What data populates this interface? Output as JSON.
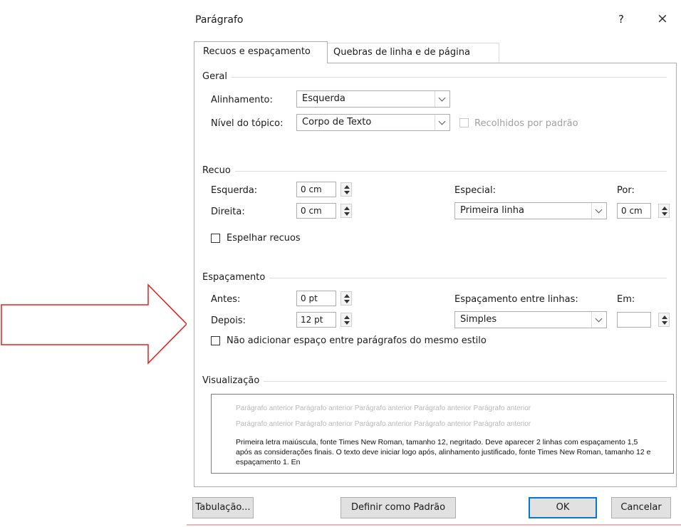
{
  "dialog": {
    "title": "Parágrafo",
    "help_label": "?",
    "close_label": "×"
  },
  "tabs": [
    {
      "label": "Recuos e espaçamento",
      "active": true
    },
    {
      "label": "Quebras de linha e de página",
      "active": false
    }
  ],
  "geral": {
    "section_label": "Geral",
    "alinhamento_label": "Alinhamento:",
    "alinhamento_value": "Esquerda",
    "nivel_label": "Nível do tópico:",
    "nivel_value": "Corpo de Texto",
    "recolhidos_label": "Recolhidos por padrão",
    "recolhidos_checked": false,
    "recolhidos_enabled": false
  },
  "recuo": {
    "section_label": "Recuo",
    "esquerda_label": "Esquerda:",
    "esquerda_value": "0 cm",
    "direita_label": "Direita:",
    "direita_value": "0 cm",
    "especial_label": "Especial:",
    "especial_value": "Primeira linha",
    "por_label": "Por:",
    "por_value": "0 cm",
    "espelhar_label": "Espelhar recuos",
    "espelhar_checked": false
  },
  "espacamento": {
    "section_label": "Espaçamento",
    "antes_label": "Antes:",
    "antes_value": "0 pt",
    "depois_label": "Depois:",
    "depois_value": "12 pt",
    "entre_linhas_label": "Espaçamento entre linhas:",
    "entre_linhas_value": "Simples",
    "em_label": "Em:",
    "em_value": "",
    "nao_adicionar_label": "Não adicionar espaço entre parágrafos do mesmo estilo",
    "nao_adicionar_checked": false
  },
  "visualizacao": {
    "section_label": "Visualização",
    "previous_line_1": "Parágrafo anterior Parágrafo anterior Parágrafo anterior Parágrafo anterior Parágrafo anterior",
    "previous_line_2": "Parágrafo anterior Parágrafo anterior Parágrafo anterior Parágrafo anterior Parágrafo anterior",
    "sample_text": "Primeira letra maiúscula, fonte Times New Roman, tamanho 12, negritado. Deve aparecer 2 linhas com espaçamento 1,5 após as considerações finais. O texto deve iniciar logo após, alinhamento justificado, fonte Times New Roman, tamanho 12 e espaçamento 1. En"
  },
  "buttons": {
    "tabulacao": "Tabulação...",
    "definir_padrao": "Definir como Padrão",
    "ok": "OK",
    "cancelar": "Cancelar"
  },
  "annotation": {
    "arrow_color": "#e0201b"
  }
}
